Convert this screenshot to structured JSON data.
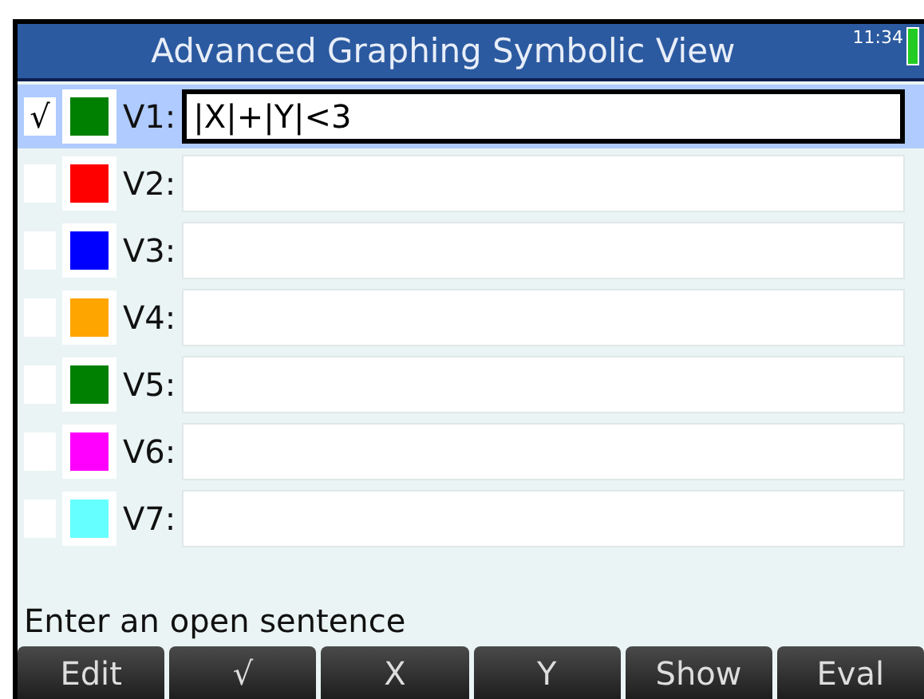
{
  "title_bar": {
    "title": "Advanced Graphing Symbolic View",
    "time": "11:34"
  },
  "functions": [
    {
      "label": "V1:",
      "checked": true,
      "selected": true,
      "color": "#008000",
      "expression": "|X|+|Y|<3"
    },
    {
      "label": "V2:",
      "checked": false,
      "selected": false,
      "color": "#ff0000"
    },
    {
      "label": "V3:",
      "checked": false,
      "selected": false,
      "color": "#0000ff"
    },
    {
      "label": "V4:",
      "checked": false,
      "selected": false,
      "color": "#ffa500"
    },
    {
      "label": "V5:",
      "checked": false,
      "selected": false,
      "color": "#008000"
    },
    {
      "label": "V6:",
      "checked": false,
      "selected": false,
      "color": "#ff00ff"
    },
    {
      "label": "V7:",
      "checked": false,
      "selected": false,
      "color": "#66ffff"
    }
  ],
  "check_mark": "√",
  "help_text": "Enter an open sentence",
  "softkeys": [
    "Edit",
    "√",
    "X",
    "Y",
    "Show",
    "Eval"
  ]
}
